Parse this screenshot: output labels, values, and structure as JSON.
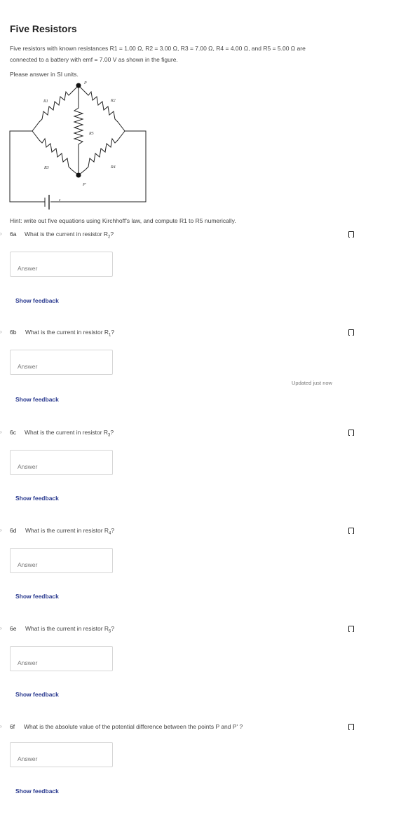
{
  "title": "Five Resistors",
  "intro": {
    "line1": "Five resistors with known resistances R1 = 1.00 Ω, R2 = 3.00 Ω, R3 = 7.00 Ω, R4 = 4.00 Ω, and R5 = 5.00 Ω are",
    "line2": "connected to a battery with emf = 7.00 V as shown in the figure."
  },
  "si_note": "Please answer in SI units.",
  "figure": {
    "labels": {
      "p": "P",
      "p_prime": "P'",
      "r1": "R1",
      "r2": "R2",
      "r3": "R3",
      "r4": "R4",
      "r5": "R5",
      "emf": "ε"
    }
  },
  "hint": "Hint: write out five equations using Kirchhoff's law,  and compute R1 to R5 numerically.",
  "questions": [
    {
      "num": "6a",
      "text_pre": "What is the current in resistor R",
      "sub": "2",
      "text_post": "?",
      "answer_placeholder": "Answer",
      "feedback": "Show feedback"
    },
    {
      "num": "6b",
      "text_pre": "What is the current in resistor R",
      "sub": "1",
      "text_post": "?",
      "answer_placeholder": "Answer",
      "feedback": "Show feedback"
    },
    {
      "num": "6c",
      "text_pre": "What is the current in resistor R",
      "sub": "3",
      "text_post": "?",
      "answer_placeholder": "Answer",
      "feedback": "Show feedback"
    },
    {
      "num": "6d",
      "text_pre": "What is the current in resistor R",
      "sub": "4",
      "text_post": "?",
      "answer_placeholder": "Answer",
      "feedback": "Show feedback"
    },
    {
      "num": "6e",
      "text_pre": "What is the current in resistor R",
      "sub": "5",
      "text_post": "?",
      "answer_placeholder": "Answer",
      "feedback": "Show feedback"
    },
    {
      "num": "6f",
      "text_pre": "What is the absolute value of the potential difference between the points P and P' ?",
      "sub": "",
      "text_post": "",
      "answer_placeholder": "Answer",
      "feedback": "Show feedback"
    }
  ],
  "status": {
    "updated": "Updated just now"
  },
  "icons": {
    "flag": "bookmark-flag-icon",
    "arrow": "question-arrow-icon"
  }
}
